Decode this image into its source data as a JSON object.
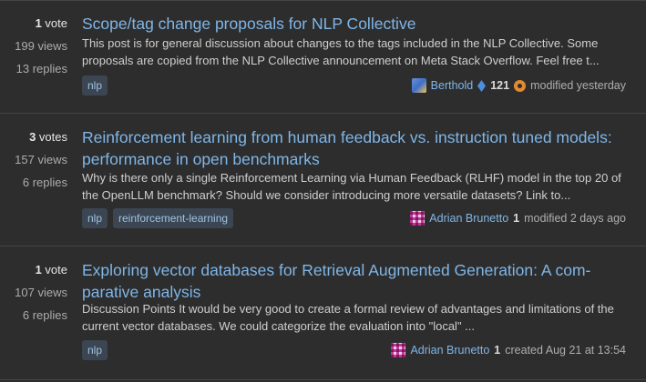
{
  "posts": [
    {
      "votes": "1",
      "votes_unit": "vote",
      "views": "199",
      "views_unit": "views",
      "replies": "13",
      "replies_unit": "replies",
      "title": "Scope/tag change proposals for NLP Collective",
      "excerpt": "This post is for general discussion about changes to the tags included in the NLP Collective. Some proposals are copied from the NLP Collective announcement on Meta Stack Overflow. Feel free t...",
      "tags": [
        "nlp"
      ],
      "author": "Berthold",
      "author_icon": "moderator-diamond-icon",
      "reputation": "121",
      "activity": "modified yesterday"
    },
    {
      "votes": "3",
      "votes_unit": "votes",
      "views": "157",
      "views_unit": "views",
      "replies": "6",
      "replies_unit": "replies",
      "title": "Reinforcement learning from human feedback vs. instruction tuned models: performance in open benchmarks",
      "excerpt": "Why is there only a single Reinforcement Learning via Human Feedback (RLHF) model in the top 20 of the OpenLLM benchmark? Should we consider introducing more versatile datasets? Link to...",
      "tags": [
        "nlp",
        "reinforcement-learning"
      ],
      "author": "Adrian Brunetto",
      "reputation": "1",
      "activity": "modified 2 days ago"
    },
    {
      "votes": "1",
      "votes_unit": "vote",
      "views": "107",
      "views_unit": "views",
      "replies": "6",
      "replies_unit": "replies",
      "title": "Exploring vector databases for Retrieval Augmented Generation: A com-parative analysis",
      "excerpt": "Discussion Points It would be very good to create a formal review of advantages and limitations of the current vector databases. We could categorize the evaluation into \"local\" ...",
      "tags": [
        "nlp"
      ],
      "author": "Adrian Brunetto",
      "reputation": "1",
      "activity": "created Aug 21 at 13:54"
    }
  ],
  "colors": {
    "background": "#2d2d2d",
    "link": "#7fb6e8",
    "tag_bg": "#3b4652",
    "tag_text": "#9fc3e3",
    "badge_bronze": "#e38a30"
  }
}
